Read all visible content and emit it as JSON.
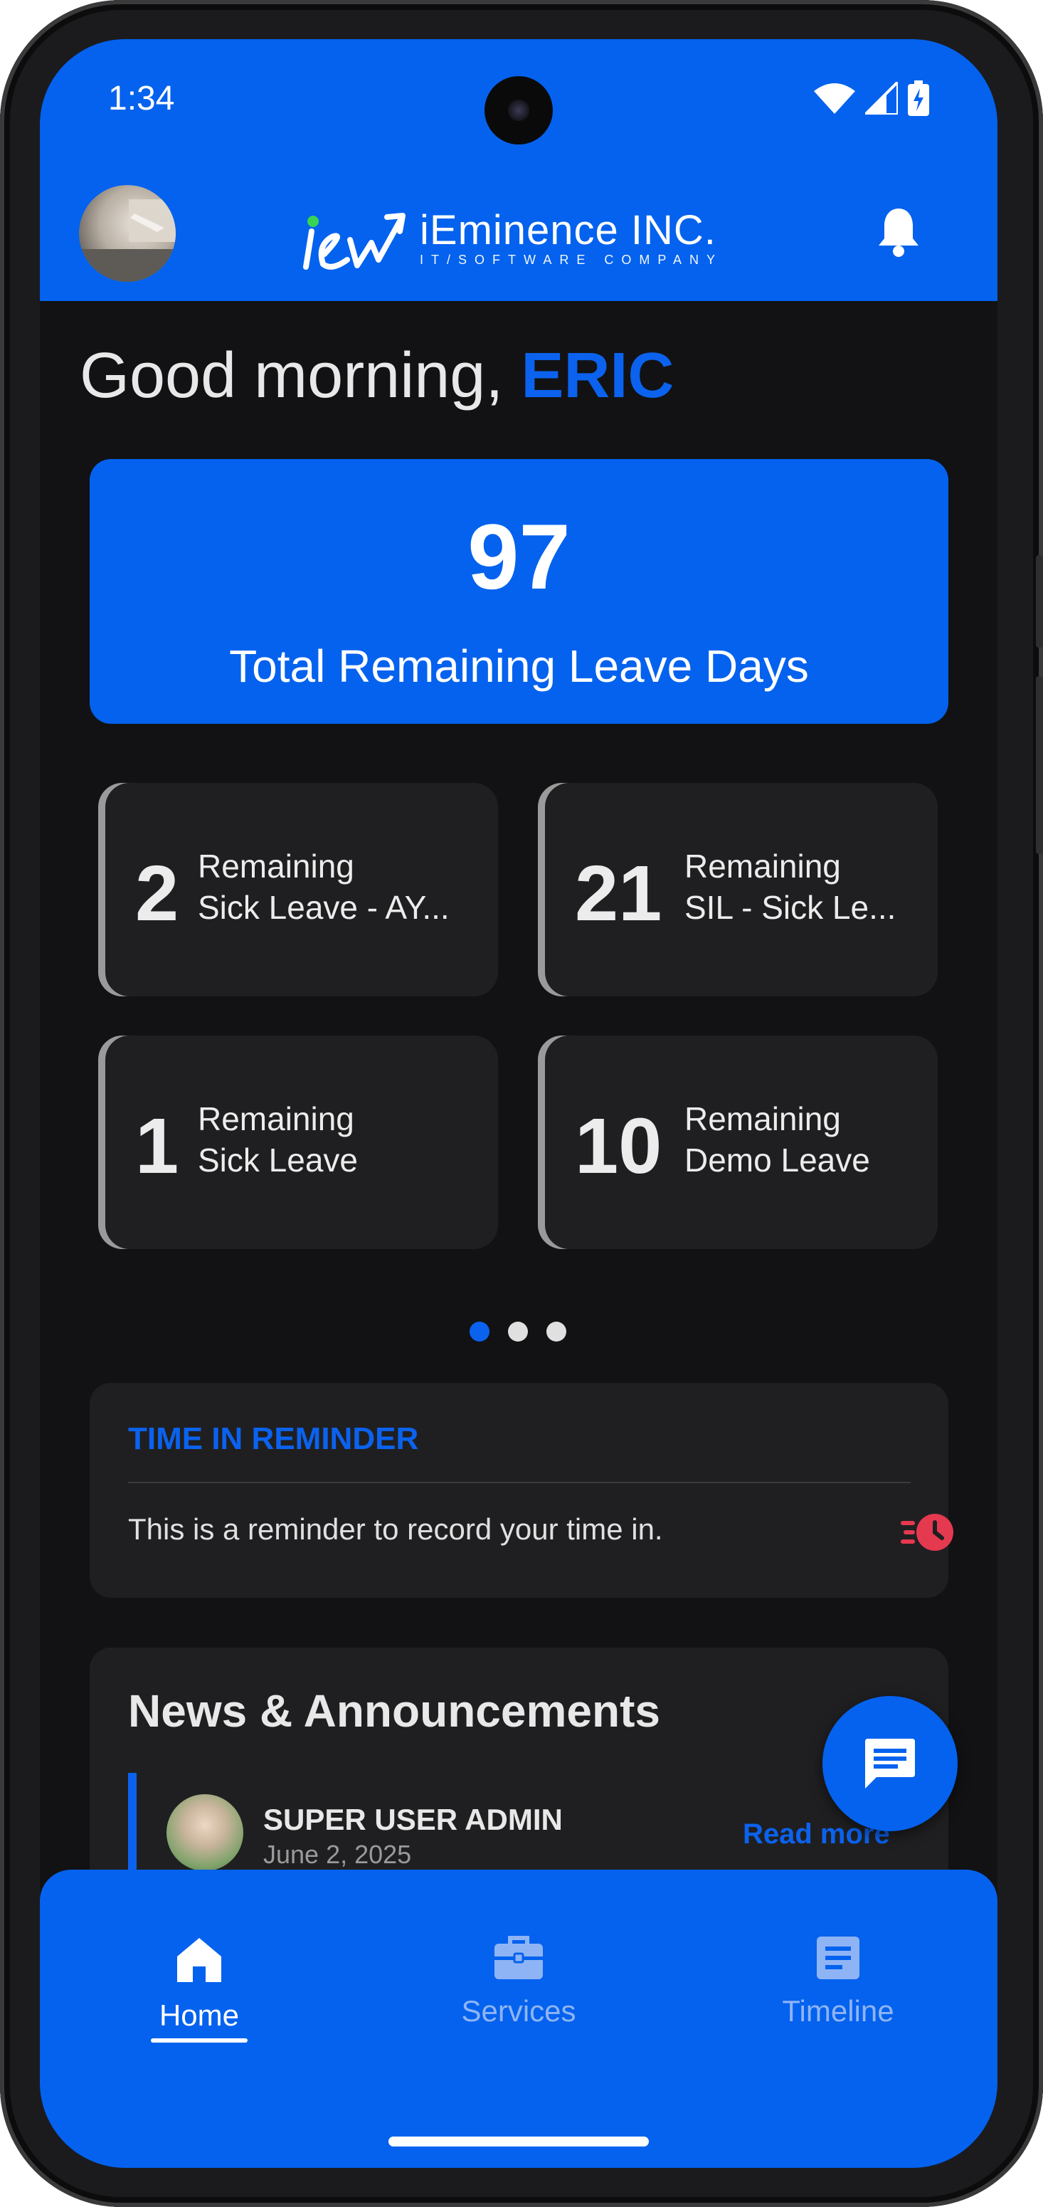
{
  "status_bar": {
    "time": "1:34"
  },
  "header": {
    "brand_name": "iEminence INC.",
    "brand_tagline": "IT/SOFTWARE COMPANY"
  },
  "greeting": {
    "prefix": "Good morning, ",
    "name": "ERIC"
  },
  "total_leave": {
    "value": "97",
    "label": "Total Remaining Leave Days"
  },
  "leave_cards": [
    {
      "value": "2",
      "line1": "Remaining",
      "line2": "Sick Leave - AY..."
    },
    {
      "value": "21",
      "line1": "Remaining",
      "line2": "SIL - Sick Le..."
    },
    {
      "value": "1",
      "line1": "Remaining",
      "line2": "Sick Leave"
    },
    {
      "value": "10",
      "line1": "Remaining",
      "line2": "Demo Leave"
    }
  ],
  "carousel": {
    "page_count": 3,
    "active_index": 0
  },
  "reminder": {
    "title": "TIME IN REMINDER",
    "text": "This is a reminder to record your time in."
  },
  "news": {
    "title": "News & Announcements",
    "items": [
      {
        "author": "SUPER USER ADMIN",
        "date": "June 2, 2025",
        "read_more": "Read more"
      }
    ]
  },
  "bottom_nav": {
    "items": [
      {
        "label": "Home",
        "icon": "home-icon",
        "active": true
      },
      {
        "label": "Services",
        "icon": "briefcase-icon",
        "active": false
      },
      {
        "label": "Timeline",
        "icon": "article-icon",
        "active": false
      }
    ]
  },
  "colors": {
    "primary": "#0462ee",
    "background": "#121214",
    "card": "#1f1f21",
    "alert": "#e53950"
  }
}
